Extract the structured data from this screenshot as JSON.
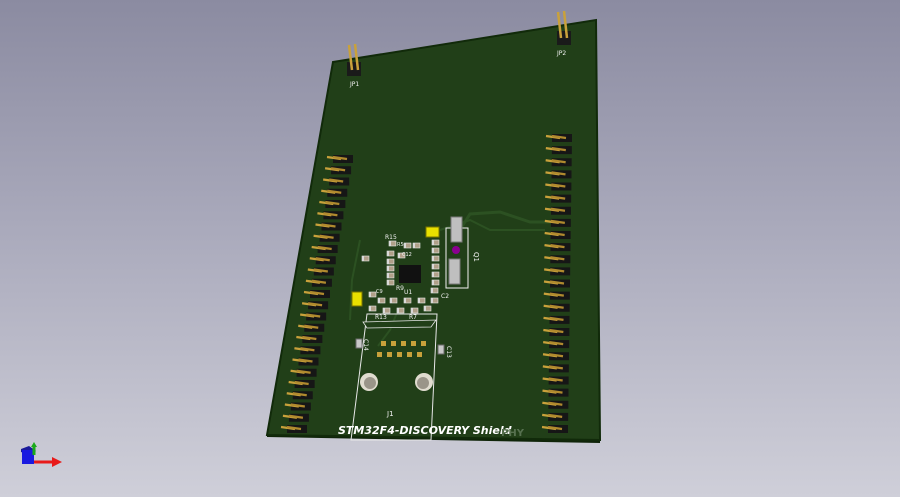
{
  "board": {
    "title": "STM32F4-DISCOVERY Shield",
    "faint_label": "PHY",
    "colors": {
      "soldermask": "#1f3d17",
      "soldermask_edge": "#122a0c",
      "silkscreen": "#f2f2f2",
      "gold": "#c9a13b",
      "header_body": "#1a1a1a"
    }
  },
  "headers": {
    "jp1": "JP1",
    "jp2": "JP2"
  },
  "components": {
    "r15": "R15",
    "r5": "R5",
    "c13_top": "C12",
    "q1": "Q1",
    "c9": "C9",
    "r9": "R9",
    "u1": "U1",
    "c2": "C2",
    "r13": "R13",
    "r7": "R7",
    "c14": "C14",
    "c13": "C13",
    "j1": "J1"
  },
  "axes": {
    "x": "x-axis-arrow",
    "y": "y-axis-arrow",
    "z": "z-axis-arrow"
  }
}
